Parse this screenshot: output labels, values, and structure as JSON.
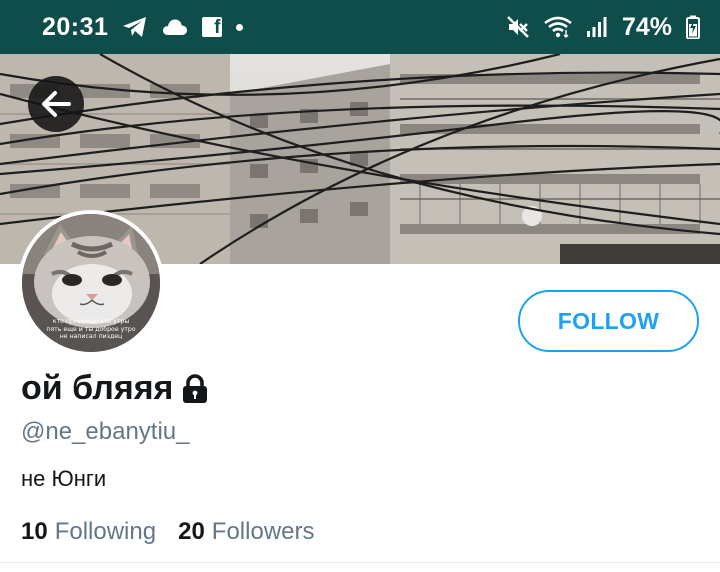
{
  "status_bar": {
    "time": "20:31",
    "left_icons": [
      "telegram-icon",
      "cloud-icon",
      "facebook-icon",
      "notification-dot-icon"
    ],
    "right_icons": [
      "mute-icon",
      "wifi-icon",
      "signal-icon",
      "battery-charging-icon"
    ],
    "battery_percent": "74%",
    "background_color": "#0f4d4a"
  },
  "banner": {
    "description_icon": "city-buildings-power-lines-photo"
  },
  "navigation": {
    "back_icon": "arrow-left-icon"
  },
  "profile": {
    "avatar_icon": "kitten-avatar-image",
    "avatar_caption_lines": [
      "кто придумал эти утры",
      "пять еще и ты доброе утро",
      "не написал пиздец"
    ],
    "display_name": "ой бляяя",
    "protected_icon": "lock-icon",
    "handle": "@ne_ebanytiu_",
    "bio": "не Юнги",
    "following_count": "10",
    "following_label": "Following",
    "followers_count": "20",
    "followers_label": "Followers"
  },
  "actions": {
    "follow_label": "FOLLOW",
    "accent_color": "#1da1f2"
  }
}
